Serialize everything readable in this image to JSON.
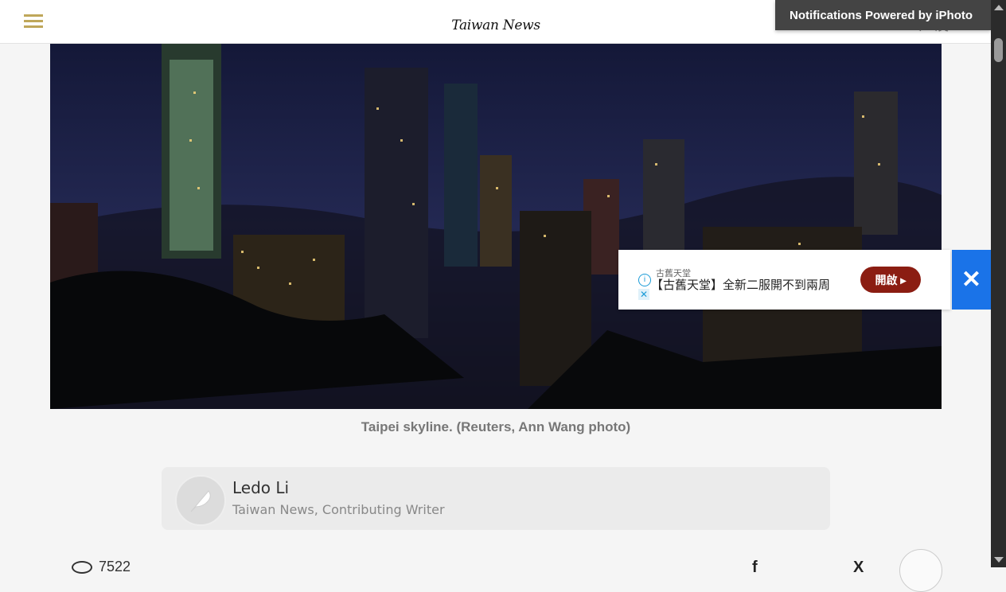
{
  "header": {
    "logo_text": "Taiwan News",
    "lang_zh": "漢",
    "lang_en": "EN",
    "notification": "Notifications Powered by iPhoto"
  },
  "hero": {
    "caption": "Taipei skyline. (Reuters, Ann Wang photo)"
  },
  "author": {
    "name": "Ledo Li",
    "role": "Taiwan News, Contributing Writer"
  },
  "ad": {
    "brand": "古舊天堂",
    "text": "【古舊天堂】全新二服開不到兩周",
    "cta": "開啟 ▸",
    "info_icon": "i",
    "x_icon": "✕",
    "close_icon": "✕"
  },
  "footer": {
    "views": "7522",
    "share_facebook": "f",
    "share_x": "X"
  },
  "colors": {
    "accent_gold": "#bfa75a",
    "ad_close_blue": "#1a73e8",
    "ad_cta": "#8b1d12"
  }
}
